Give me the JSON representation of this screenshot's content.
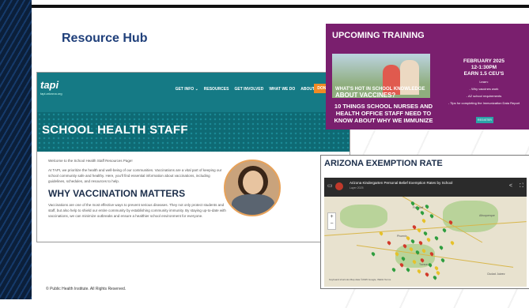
{
  "slide": {
    "title": "Resource Hub",
    "footer": "© Public Health Institute. All Rights Reserved."
  },
  "school_site": {
    "logo": "tapi",
    "logo_sub": "tapi.arizona.org",
    "nav": [
      "GET INFO ⌄",
      "RESOURCES",
      "GET INVOLVED",
      "WHAT WE DO",
      "ABOUT US ⌄"
    ],
    "donate": "DONATE",
    "cart_icon": "cart-icon",
    "hero_title": "SCHOOL HEALTH STAFF",
    "welcome": "Welcome to the School Health Staff Resources Page!",
    "intro": "At TAPI, we prioritize the health and well-being of our communities. Vaccinations are a vital part of keeping our school community safe and healthy. Here, you'll find essential information about vaccinations, including guidelines, schedules, and resources to help.",
    "section_heading": "WHY VACCINATION MATTERS",
    "section_text": "Vaccinations are one of the most effective ways to prevent serious diseases. They not only protect students and staff, but also help to shield our entire community by establishing community immunity. By staying up-to-date with vaccinations, we can minimize outbreaks and ensure a healthier school environment for everyone.",
    "chat_label": "EN"
  },
  "training": {
    "title": "UPCOMING TRAINING",
    "photo_question_small": "WHAT'S HOT IN SCHOOL KNOWLEDGE",
    "photo_question": "ABOUT VACCINES?",
    "subtitle": "10 THINGS SCHOOL NURSES AND HEALTH OFFICE STAFF NEED TO KNOW ABOUT WHY WE IMMUNIZE",
    "date": "FEBRUARY 2025",
    "time": "12-1:30PM",
    "ceu": "EARN 1.5 CEU'S",
    "learn_heading": "Learn:",
    "learn_items": [
      "- Why vaccines work",
      "- AZ school requirements",
      "- Tips for completing the Immunization Data Report"
    ],
    "button": "REGISTER"
  },
  "exemption": {
    "title": "ARIZONA EXEMPTION RATE",
    "map_title": "Arizona Kindergarten Personal Belief Exemption Rates by School",
    "map_subtitle": "Layer 2025",
    "map_labels": [
      "Flagstaff",
      "Albuquerque",
      "Phoenix",
      "Tucson",
      "Ciudad Juárez"
    ],
    "map_caption": "Keyboard shortcuts   Map data ©2025 Google, INEGI   Terms",
    "colors": {
      "low": "#2f9e3f",
      "mid": "#e6c12a",
      "high": "#d23a2a"
    }
  }
}
